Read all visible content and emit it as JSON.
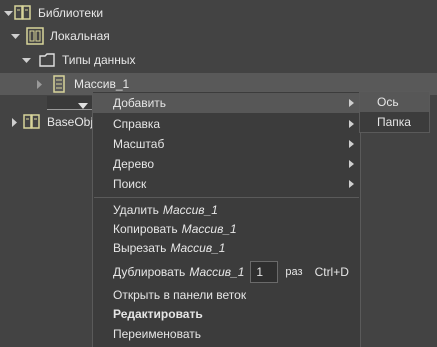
{
  "tree": {
    "libraries": "Библиотеки",
    "local": "Локальная",
    "data_types": "Типы данных",
    "array": "Массив_1",
    "baseobj": "BaseObj"
  },
  "context_menu": {
    "add": "Добавить",
    "help": "Справка",
    "scale": "Масштаб",
    "tree": "Дерево",
    "search": "Поиск",
    "delete": "Удалить",
    "copy": "Копировать",
    "cut": "Вырезать",
    "duplicate": "Дублировать",
    "target": "Массив_1",
    "duplicate_count": "1",
    "duplicate_unit": "раз",
    "duplicate_shortcut": "Ctrl+D",
    "open_in_branch_panel": "Открыть в панели веток",
    "edit": "Редактировать",
    "rename": "Переименовать"
  },
  "submenu": {
    "axis": "Ось",
    "folder": "Папка"
  },
  "colors": {
    "background": "#434343",
    "menu_bg": "#3c3c3c",
    "hover": "#575757",
    "icon_yellow": "#d8d49a"
  }
}
